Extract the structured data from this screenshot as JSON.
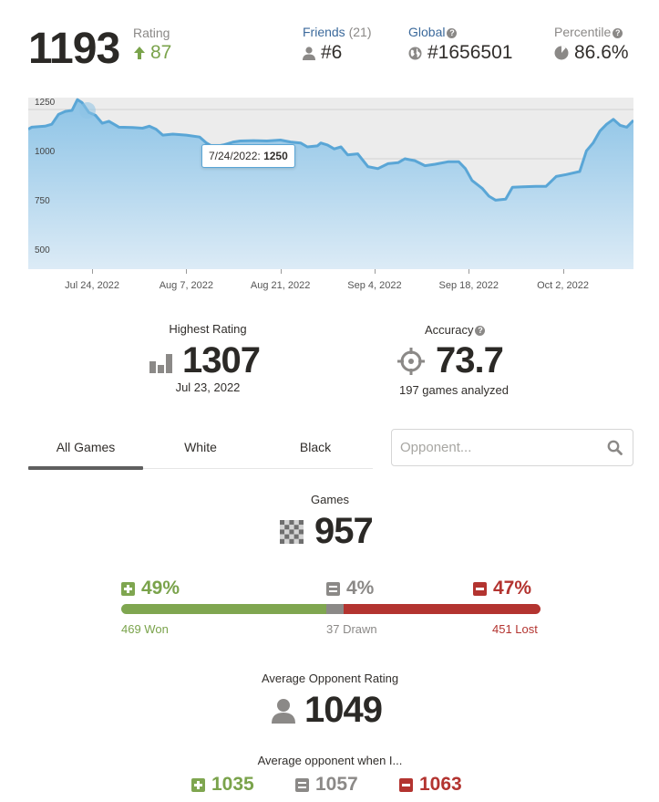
{
  "header": {
    "rating": "1193",
    "rating_label": "Rating",
    "rating_change": "87",
    "friends_label": "Friends",
    "friends_count": "(21)",
    "friends_rank": "#6",
    "global_label": "Global",
    "global_rank": "#1656501",
    "percentile_label": "Percentile",
    "percentile_value": "86.6%"
  },
  "chart_data": {
    "type": "area",
    "x_tick_labels": [
      "Jul 24, 2022",
      "Aug 7, 2022",
      "Aug 21, 2022",
      "Sep 4, 2022",
      "Sep 18, 2022",
      "Oct 2, 2022"
    ],
    "x_tick_days": [
      24,
      38,
      52,
      66,
      80,
      94
    ],
    "y_ticks": [
      1250,
      1000,
      750,
      500
    ],
    "ylim": [
      440,
      1310
    ],
    "xlim_days": [
      14.5,
      104.5
    ],
    "grid": true,
    "color": "#5aa6d6",
    "day_offset_origin": "2022-07-01",
    "series": [
      {
        "name": "Rating",
        "points": [
          [
            14.5,
            1150
          ],
          [
            15,
            1160
          ],
          [
            17,
            1165
          ],
          [
            18,
            1175
          ],
          [
            19,
            1225
          ],
          [
            20,
            1240
          ],
          [
            21,
            1245
          ],
          [
            21.8,
            1300
          ],
          [
            22.5,
            1285
          ],
          [
            23.5,
            1235
          ],
          [
            24.5,
            1220
          ],
          [
            25.5,
            1180
          ],
          [
            26.5,
            1190
          ],
          [
            28,
            1160
          ],
          [
            30,
            1158
          ],
          [
            31.5,
            1155
          ],
          [
            32.5,
            1165
          ],
          [
            33.5,
            1150
          ],
          [
            34.5,
            1120
          ],
          [
            36,
            1125
          ],
          [
            38,
            1120
          ],
          [
            40,
            1110
          ],
          [
            41,
            1080
          ],
          [
            42,
            1060
          ],
          [
            43.5,
            1070
          ],
          [
            45,
            1085
          ],
          [
            46,
            1090
          ],
          [
            48,
            1092
          ],
          [
            50,
            1090
          ],
          [
            52,
            1095
          ],
          [
            53.5,
            1085
          ],
          [
            55,
            1080
          ],
          [
            56,
            1060
          ],
          [
            57.5,
            1065
          ],
          [
            58,
            1080
          ],
          [
            59,
            1070
          ],
          [
            60,
            1050
          ],
          [
            61,
            1060
          ],
          [
            62,
            1020
          ],
          [
            63.5,
            1025
          ],
          [
            65,
            960
          ],
          [
            66.5,
            950
          ],
          [
            68,
            975
          ],
          [
            69.5,
            980
          ],
          [
            70.5,
            1000
          ],
          [
            72,
            990
          ],
          [
            73.5,
            965
          ],
          [
            75,
            972
          ],
          [
            77,
            985
          ],
          [
            78.5,
            985
          ],
          [
            79.5,
            950
          ],
          [
            80.5,
            890
          ],
          [
            82,
            850
          ],
          [
            83,
            810
          ],
          [
            84,
            790
          ],
          [
            85.5,
            795
          ],
          [
            86.5,
            855
          ],
          [
            88,
            858
          ],
          [
            90,
            860
          ],
          [
            91.5,
            860
          ],
          [
            93,
            910
          ],
          [
            94.5,
            920
          ],
          [
            96.5,
            935
          ],
          [
            97.5,
            1040
          ],
          [
            98.5,
            1080
          ],
          [
            99.5,
            1140
          ],
          [
            100.5,
            1175
          ],
          [
            101.5,
            1200
          ],
          [
            102.5,
            1170
          ],
          [
            103.5,
            1160
          ],
          [
            104.5,
            1195
          ]
        ]
      }
    ],
    "tooltip": {
      "date": "7/24/2022:",
      "value": "1250"
    }
  },
  "highest": {
    "label": "Highest Rating",
    "value": "1307",
    "date": "Jul 23, 2022"
  },
  "accuracy": {
    "label": "Accuracy",
    "value": "73.7",
    "sub": "197 games analyzed"
  },
  "tabs": [
    "All Games",
    "White",
    "Black"
  ],
  "search": {
    "placeholder": "Opponent..."
  },
  "games": {
    "label": "Games",
    "value": "957"
  },
  "wdl": {
    "won_pct": "49%",
    "drawn_pct": "4%",
    "lost_pct": "47%",
    "won_frac": 0.49,
    "drawn_frac": 0.04,
    "lost_frac": 0.47,
    "won_text": "469 Won",
    "drawn_text": "37 Drawn",
    "lost_text": "451 Lost",
    "colors": {
      "won": "#7fa650",
      "drawn": "#8b8987",
      "lost": "#b33430"
    }
  },
  "avg_opponent": {
    "label": "Average Opponent Rating",
    "value": "1049"
  },
  "avg_when": {
    "label": "Average opponent when I...",
    "won": "1035",
    "drawn": "1057",
    "lost": "1063"
  }
}
